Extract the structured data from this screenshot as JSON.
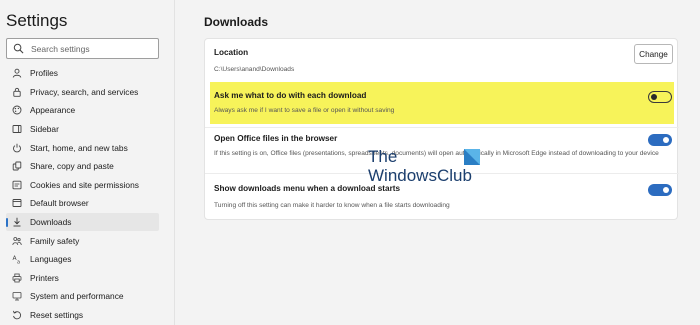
{
  "sidebar": {
    "title": "Settings",
    "search_placeholder": "Search settings",
    "items": [
      {
        "label": "Profiles",
        "icon": "profile-icon"
      },
      {
        "label": "Privacy, search, and services",
        "icon": "lock-icon"
      },
      {
        "label": "Appearance",
        "icon": "palette-icon"
      },
      {
        "label": "Sidebar",
        "icon": "sidebar-icon"
      },
      {
        "label": "Start, home, and new tabs",
        "icon": "power-icon"
      },
      {
        "label": "Share, copy and paste",
        "icon": "share-icon"
      },
      {
        "label": "Cookies and site permissions",
        "icon": "cookie-icon"
      },
      {
        "label": "Default browser",
        "icon": "browser-icon"
      },
      {
        "label": "Downloads",
        "icon": "download-icon",
        "active": true
      },
      {
        "label": "Family safety",
        "icon": "family-icon"
      },
      {
        "label": "Languages",
        "icon": "languages-icon"
      },
      {
        "label": "Printers",
        "icon": "printer-icon"
      },
      {
        "label": "System and performance",
        "icon": "system-icon"
      },
      {
        "label": "Reset settings",
        "icon": "reset-icon"
      }
    ]
  },
  "main": {
    "heading": "Downloads",
    "location": {
      "title": "Location",
      "path": "C:\\Users\\anand\\Downloads",
      "button": "Change"
    },
    "ask": {
      "title": "Ask me what to do with each download",
      "desc": "Always ask me if I want to save a file or open it without saving",
      "enabled": false
    },
    "office": {
      "title": "Open Office files in the browser",
      "desc": "If this setting is on, Office files (presentations, spreadsheets, documents) will open automatically in Microsoft Edge instead of downloading to your device",
      "enabled": true
    },
    "menu": {
      "title": "Show downloads menu when a download starts",
      "desc": "Turning off this setting can make it harder to know when a file starts downloading",
      "enabled": true
    }
  },
  "watermark": {
    "line1": "The",
    "line2": "WindowsClub"
  },
  "colors": {
    "accent": "#2c6cc0",
    "highlight": "#f7f35a",
    "watermark": "#1c3f6e"
  }
}
